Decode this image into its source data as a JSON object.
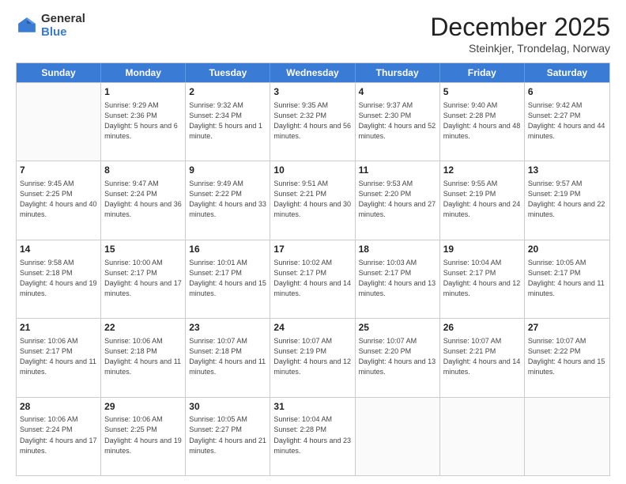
{
  "logo": {
    "general": "General",
    "blue": "Blue"
  },
  "header": {
    "month": "December 2025",
    "location": "Steinkjer, Trondelag, Norway"
  },
  "days": [
    "Sunday",
    "Monday",
    "Tuesday",
    "Wednesday",
    "Thursday",
    "Friday",
    "Saturday"
  ],
  "rows": [
    [
      {
        "day": "",
        "empty": true
      },
      {
        "day": "1",
        "sunrise": "Sunrise: 9:29 AM",
        "sunset": "Sunset: 2:36 PM",
        "daylight": "Daylight: 5 hours and 6 minutes."
      },
      {
        "day": "2",
        "sunrise": "Sunrise: 9:32 AM",
        "sunset": "Sunset: 2:34 PM",
        "daylight": "Daylight: 5 hours and 1 minute."
      },
      {
        "day": "3",
        "sunrise": "Sunrise: 9:35 AM",
        "sunset": "Sunset: 2:32 PM",
        "daylight": "Daylight: 4 hours and 56 minutes."
      },
      {
        "day": "4",
        "sunrise": "Sunrise: 9:37 AM",
        "sunset": "Sunset: 2:30 PM",
        "daylight": "Daylight: 4 hours and 52 minutes."
      },
      {
        "day": "5",
        "sunrise": "Sunrise: 9:40 AM",
        "sunset": "Sunset: 2:28 PM",
        "daylight": "Daylight: 4 hours and 48 minutes."
      },
      {
        "day": "6",
        "sunrise": "Sunrise: 9:42 AM",
        "sunset": "Sunset: 2:27 PM",
        "daylight": "Daylight: 4 hours and 44 minutes."
      }
    ],
    [
      {
        "day": "7",
        "sunrise": "Sunrise: 9:45 AM",
        "sunset": "Sunset: 2:25 PM",
        "daylight": "Daylight: 4 hours and 40 minutes."
      },
      {
        "day": "8",
        "sunrise": "Sunrise: 9:47 AM",
        "sunset": "Sunset: 2:24 PM",
        "daylight": "Daylight: 4 hours and 36 minutes."
      },
      {
        "day": "9",
        "sunrise": "Sunrise: 9:49 AM",
        "sunset": "Sunset: 2:22 PM",
        "daylight": "Daylight: 4 hours and 33 minutes."
      },
      {
        "day": "10",
        "sunrise": "Sunrise: 9:51 AM",
        "sunset": "Sunset: 2:21 PM",
        "daylight": "Daylight: 4 hours and 30 minutes."
      },
      {
        "day": "11",
        "sunrise": "Sunrise: 9:53 AM",
        "sunset": "Sunset: 2:20 PM",
        "daylight": "Daylight: 4 hours and 27 minutes."
      },
      {
        "day": "12",
        "sunrise": "Sunrise: 9:55 AM",
        "sunset": "Sunset: 2:19 PM",
        "daylight": "Daylight: 4 hours and 24 minutes."
      },
      {
        "day": "13",
        "sunrise": "Sunrise: 9:57 AM",
        "sunset": "Sunset: 2:19 PM",
        "daylight": "Daylight: 4 hours and 22 minutes."
      }
    ],
    [
      {
        "day": "14",
        "sunrise": "Sunrise: 9:58 AM",
        "sunset": "Sunset: 2:18 PM",
        "daylight": "Daylight: 4 hours and 19 minutes."
      },
      {
        "day": "15",
        "sunrise": "Sunrise: 10:00 AM",
        "sunset": "Sunset: 2:17 PM",
        "daylight": "Daylight: 4 hours and 17 minutes."
      },
      {
        "day": "16",
        "sunrise": "Sunrise: 10:01 AM",
        "sunset": "Sunset: 2:17 PM",
        "daylight": "Daylight: 4 hours and 15 minutes."
      },
      {
        "day": "17",
        "sunrise": "Sunrise: 10:02 AM",
        "sunset": "Sunset: 2:17 PM",
        "daylight": "Daylight: 4 hours and 14 minutes."
      },
      {
        "day": "18",
        "sunrise": "Sunrise: 10:03 AM",
        "sunset": "Sunset: 2:17 PM",
        "daylight": "Daylight: 4 hours and 13 minutes."
      },
      {
        "day": "19",
        "sunrise": "Sunrise: 10:04 AM",
        "sunset": "Sunset: 2:17 PM",
        "daylight": "Daylight: 4 hours and 12 minutes."
      },
      {
        "day": "20",
        "sunrise": "Sunrise: 10:05 AM",
        "sunset": "Sunset: 2:17 PM",
        "daylight": "Daylight: 4 hours and 11 minutes."
      }
    ],
    [
      {
        "day": "21",
        "sunrise": "Sunrise: 10:06 AM",
        "sunset": "Sunset: 2:17 PM",
        "daylight": "Daylight: 4 hours and 11 minutes."
      },
      {
        "day": "22",
        "sunrise": "Sunrise: 10:06 AM",
        "sunset": "Sunset: 2:18 PM",
        "daylight": "Daylight: 4 hours and 11 minutes."
      },
      {
        "day": "23",
        "sunrise": "Sunrise: 10:07 AM",
        "sunset": "Sunset: 2:18 PM",
        "daylight": "Daylight: 4 hours and 11 minutes."
      },
      {
        "day": "24",
        "sunrise": "Sunrise: 10:07 AM",
        "sunset": "Sunset: 2:19 PM",
        "daylight": "Daylight: 4 hours and 12 minutes."
      },
      {
        "day": "25",
        "sunrise": "Sunrise: 10:07 AM",
        "sunset": "Sunset: 2:20 PM",
        "daylight": "Daylight: 4 hours and 13 minutes."
      },
      {
        "day": "26",
        "sunrise": "Sunrise: 10:07 AM",
        "sunset": "Sunset: 2:21 PM",
        "daylight": "Daylight: 4 hours and 14 minutes."
      },
      {
        "day": "27",
        "sunrise": "Sunrise: 10:07 AM",
        "sunset": "Sunset: 2:22 PM",
        "daylight": "Daylight: 4 hours and 15 minutes."
      }
    ],
    [
      {
        "day": "28",
        "sunrise": "Sunrise: 10:06 AM",
        "sunset": "Sunset: 2:24 PM",
        "daylight": "Daylight: 4 hours and 17 minutes."
      },
      {
        "day": "29",
        "sunrise": "Sunrise: 10:06 AM",
        "sunset": "Sunset: 2:25 PM",
        "daylight": "Daylight: 4 hours and 19 minutes."
      },
      {
        "day": "30",
        "sunrise": "Sunrise: 10:05 AM",
        "sunset": "Sunset: 2:27 PM",
        "daylight": "Daylight: 4 hours and 21 minutes."
      },
      {
        "day": "31",
        "sunrise": "Sunrise: 10:04 AM",
        "sunset": "Sunset: 2:28 PM",
        "daylight": "Daylight: 4 hours and 23 minutes."
      },
      {
        "day": "",
        "empty": true
      },
      {
        "day": "",
        "empty": true
      },
      {
        "day": "",
        "empty": true
      }
    ]
  ]
}
